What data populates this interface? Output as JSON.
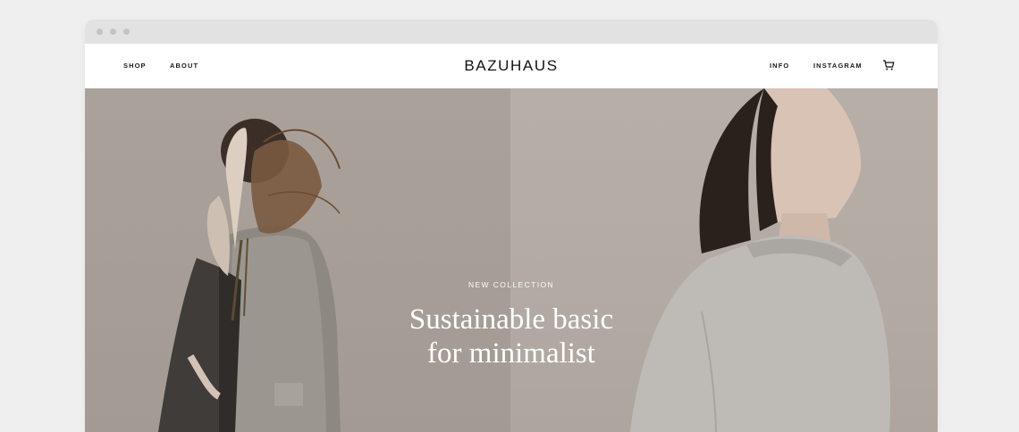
{
  "nav": {
    "left_links": [
      "SHOP",
      "ABOUT"
    ],
    "right_links": [
      "INFO",
      "INSTAGRAM"
    ],
    "logo": "BAZUHAUS",
    "cart_icon": "cart-icon"
  },
  "hero": {
    "eyebrow": "NEW COLLECTION",
    "headline_line1": "Sustainable basic",
    "headline_line2": "for minimalist"
  },
  "colors": {
    "page_bg": "#efefef",
    "chrome": "#e2e2e2",
    "hero_left": "#a69e96",
    "hero_right": "#b2aaa3",
    "text_dark": "#111111"
  }
}
